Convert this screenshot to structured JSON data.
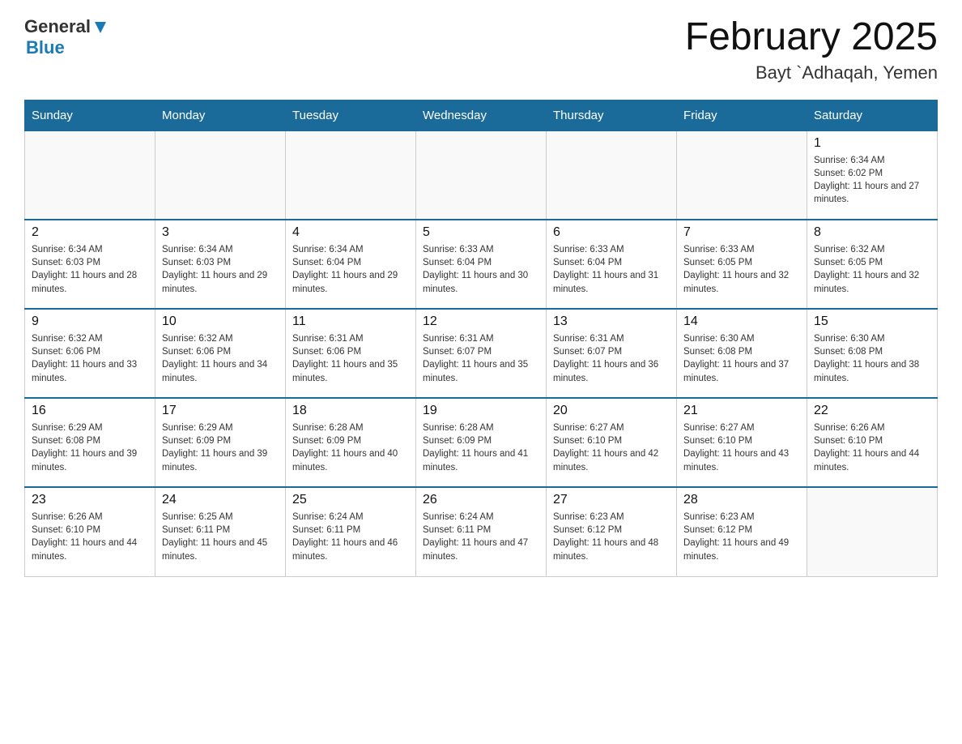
{
  "header": {
    "logo_general": "General",
    "logo_blue": "Blue",
    "month_title": "February 2025",
    "location": "Bayt `Adhaqah, Yemen"
  },
  "days_of_week": [
    "Sunday",
    "Monday",
    "Tuesday",
    "Wednesday",
    "Thursday",
    "Friday",
    "Saturday"
  ],
  "weeks": [
    [
      {
        "day": "",
        "info": ""
      },
      {
        "day": "",
        "info": ""
      },
      {
        "day": "",
        "info": ""
      },
      {
        "day": "",
        "info": ""
      },
      {
        "day": "",
        "info": ""
      },
      {
        "day": "",
        "info": ""
      },
      {
        "day": "1",
        "info": "Sunrise: 6:34 AM\nSunset: 6:02 PM\nDaylight: 11 hours and 27 minutes."
      }
    ],
    [
      {
        "day": "2",
        "info": "Sunrise: 6:34 AM\nSunset: 6:03 PM\nDaylight: 11 hours and 28 minutes."
      },
      {
        "day": "3",
        "info": "Sunrise: 6:34 AM\nSunset: 6:03 PM\nDaylight: 11 hours and 29 minutes."
      },
      {
        "day": "4",
        "info": "Sunrise: 6:34 AM\nSunset: 6:04 PM\nDaylight: 11 hours and 29 minutes."
      },
      {
        "day": "5",
        "info": "Sunrise: 6:33 AM\nSunset: 6:04 PM\nDaylight: 11 hours and 30 minutes."
      },
      {
        "day": "6",
        "info": "Sunrise: 6:33 AM\nSunset: 6:04 PM\nDaylight: 11 hours and 31 minutes."
      },
      {
        "day": "7",
        "info": "Sunrise: 6:33 AM\nSunset: 6:05 PM\nDaylight: 11 hours and 32 minutes."
      },
      {
        "day": "8",
        "info": "Sunrise: 6:32 AM\nSunset: 6:05 PM\nDaylight: 11 hours and 32 minutes."
      }
    ],
    [
      {
        "day": "9",
        "info": "Sunrise: 6:32 AM\nSunset: 6:06 PM\nDaylight: 11 hours and 33 minutes."
      },
      {
        "day": "10",
        "info": "Sunrise: 6:32 AM\nSunset: 6:06 PM\nDaylight: 11 hours and 34 minutes."
      },
      {
        "day": "11",
        "info": "Sunrise: 6:31 AM\nSunset: 6:06 PM\nDaylight: 11 hours and 35 minutes."
      },
      {
        "day": "12",
        "info": "Sunrise: 6:31 AM\nSunset: 6:07 PM\nDaylight: 11 hours and 35 minutes."
      },
      {
        "day": "13",
        "info": "Sunrise: 6:31 AM\nSunset: 6:07 PM\nDaylight: 11 hours and 36 minutes."
      },
      {
        "day": "14",
        "info": "Sunrise: 6:30 AM\nSunset: 6:08 PM\nDaylight: 11 hours and 37 minutes."
      },
      {
        "day": "15",
        "info": "Sunrise: 6:30 AM\nSunset: 6:08 PM\nDaylight: 11 hours and 38 minutes."
      }
    ],
    [
      {
        "day": "16",
        "info": "Sunrise: 6:29 AM\nSunset: 6:08 PM\nDaylight: 11 hours and 39 minutes."
      },
      {
        "day": "17",
        "info": "Sunrise: 6:29 AM\nSunset: 6:09 PM\nDaylight: 11 hours and 39 minutes."
      },
      {
        "day": "18",
        "info": "Sunrise: 6:28 AM\nSunset: 6:09 PM\nDaylight: 11 hours and 40 minutes."
      },
      {
        "day": "19",
        "info": "Sunrise: 6:28 AM\nSunset: 6:09 PM\nDaylight: 11 hours and 41 minutes."
      },
      {
        "day": "20",
        "info": "Sunrise: 6:27 AM\nSunset: 6:10 PM\nDaylight: 11 hours and 42 minutes."
      },
      {
        "day": "21",
        "info": "Sunrise: 6:27 AM\nSunset: 6:10 PM\nDaylight: 11 hours and 43 minutes."
      },
      {
        "day": "22",
        "info": "Sunrise: 6:26 AM\nSunset: 6:10 PM\nDaylight: 11 hours and 44 minutes."
      }
    ],
    [
      {
        "day": "23",
        "info": "Sunrise: 6:26 AM\nSunset: 6:10 PM\nDaylight: 11 hours and 44 minutes."
      },
      {
        "day": "24",
        "info": "Sunrise: 6:25 AM\nSunset: 6:11 PM\nDaylight: 11 hours and 45 minutes."
      },
      {
        "day": "25",
        "info": "Sunrise: 6:24 AM\nSunset: 6:11 PM\nDaylight: 11 hours and 46 minutes."
      },
      {
        "day": "26",
        "info": "Sunrise: 6:24 AM\nSunset: 6:11 PM\nDaylight: 11 hours and 47 minutes."
      },
      {
        "day": "27",
        "info": "Sunrise: 6:23 AM\nSunset: 6:12 PM\nDaylight: 11 hours and 48 minutes."
      },
      {
        "day": "28",
        "info": "Sunrise: 6:23 AM\nSunset: 6:12 PM\nDaylight: 11 hours and 49 minutes."
      },
      {
        "day": "",
        "info": ""
      }
    ]
  ]
}
